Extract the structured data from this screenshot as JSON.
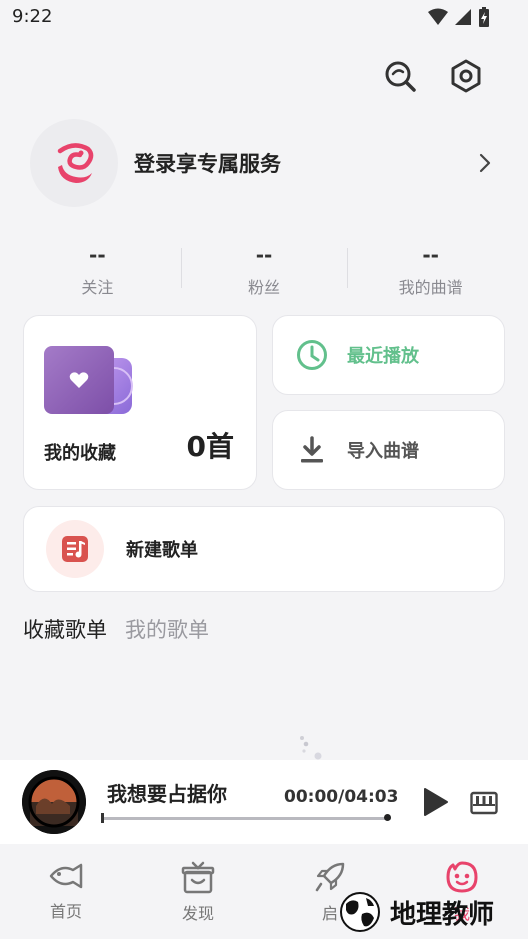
{
  "status_bar": {
    "time": "9:22"
  },
  "profile": {
    "login_text": "登录享专属服务"
  },
  "stats": [
    {
      "value": "--",
      "label": "关注"
    },
    {
      "value": "--",
      "label": "粉丝"
    },
    {
      "value": "--",
      "label": "我的曲谱"
    }
  ],
  "favorites": {
    "label": "我的收藏",
    "count": "0首"
  },
  "recent": {
    "label": "最近播放"
  },
  "import": {
    "label": "导入曲谱"
  },
  "new_playlist": {
    "label": "新建歌单"
  },
  "tabs": [
    {
      "label": "收藏歌单",
      "active": true
    },
    {
      "label": "我的歌单",
      "active": false
    }
  ],
  "player": {
    "title": "我想要占据你",
    "time": "00:00/04:03",
    "progress": 0
  },
  "nav": [
    {
      "label": "首页",
      "icon": "fish-icon"
    },
    {
      "label": "发现",
      "icon": "gift-box-icon"
    },
    {
      "label": "启",
      "icon": "rocket-icon"
    },
    {
      "label": "我",
      "icon": "smiley-face-icon",
      "active": true
    }
  ],
  "watermark": {
    "text": "地理教师"
  },
  "colors": {
    "accent": "#e8436b",
    "green": "#62c08c",
    "purple": "#9b5fc0",
    "red": "#d9534f"
  }
}
